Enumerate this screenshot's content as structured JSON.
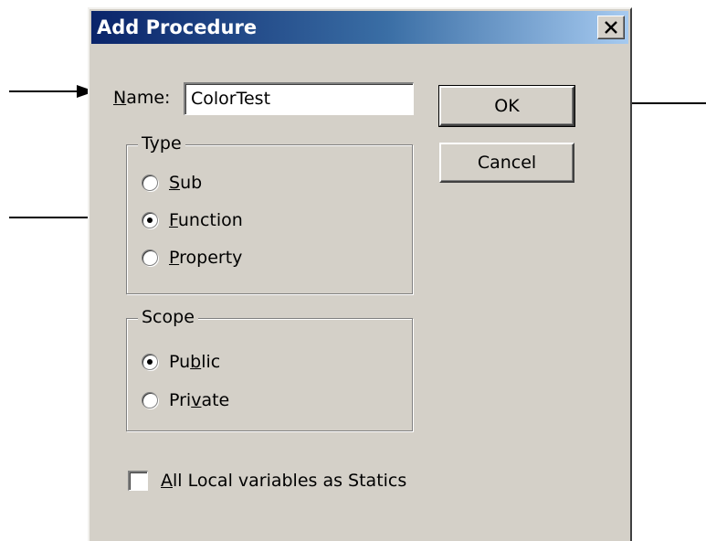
{
  "dialog": {
    "title": "Add Procedure",
    "close_glyph": "✕"
  },
  "name_field": {
    "label_mnemonic": "N",
    "label_rest": "ame:",
    "value": "ColorTest"
  },
  "buttons": {
    "ok": "OK",
    "cancel": "Cancel"
  },
  "type_group": {
    "label": "Type",
    "options": [
      {
        "mnemonic": "S",
        "rest": "ub",
        "selected": false
      },
      {
        "mnemonic": "F",
        "rest": "unction",
        "selected": true
      },
      {
        "mnemonic": "P",
        "rest": "roperty",
        "selected": false
      }
    ]
  },
  "scope_group": {
    "label": "Scope",
    "options": [
      {
        "before": "Pu",
        "mnemonic": "b",
        "after": "lic",
        "selected": true
      },
      {
        "before": "Pri",
        "mnemonic": "v",
        "after": "ate",
        "selected": false
      }
    ]
  },
  "statics_checkbox": {
    "mnemonic": "A",
    "rest": "ll Local variables as Statics",
    "checked": false
  },
  "colors": {
    "dialog_bg": "#d4d0c8",
    "title_gradient_start": "#0a246a",
    "title_gradient_end": "#a6caf0"
  }
}
